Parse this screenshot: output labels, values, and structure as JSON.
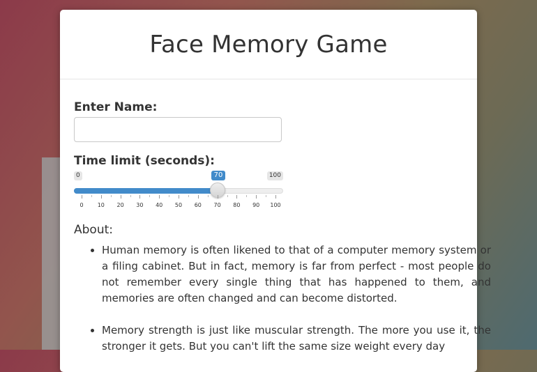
{
  "page": {
    "title": "Face Memory Game"
  },
  "form": {
    "name_label": "Enter Name:",
    "name_value": "",
    "time_label": "Time limit (seconds):"
  },
  "slider": {
    "min_label": "0",
    "max_label": "100",
    "value_label": "70",
    "value": 70,
    "min": 0,
    "max": 100,
    "tick_labels": [
      "0",
      "10",
      "20",
      "30",
      "40",
      "50",
      "60",
      "70",
      "80",
      "90",
      "100"
    ],
    "accent_color": "#428bca"
  },
  "about": {
    "heading": "About:",
    "items": [
      "Human memory is often likened to that of a computer memory system or a filing cabinet. But in fact, memory is far from perfect - most people do not remember every single thing that has happened to them, and memories are often changed and can become distorted.",
      "Memory strength is just like muscular strength. The more you use it, the stronger it gets. But you can't lift the same size weight every day"
    ]
  }
}
